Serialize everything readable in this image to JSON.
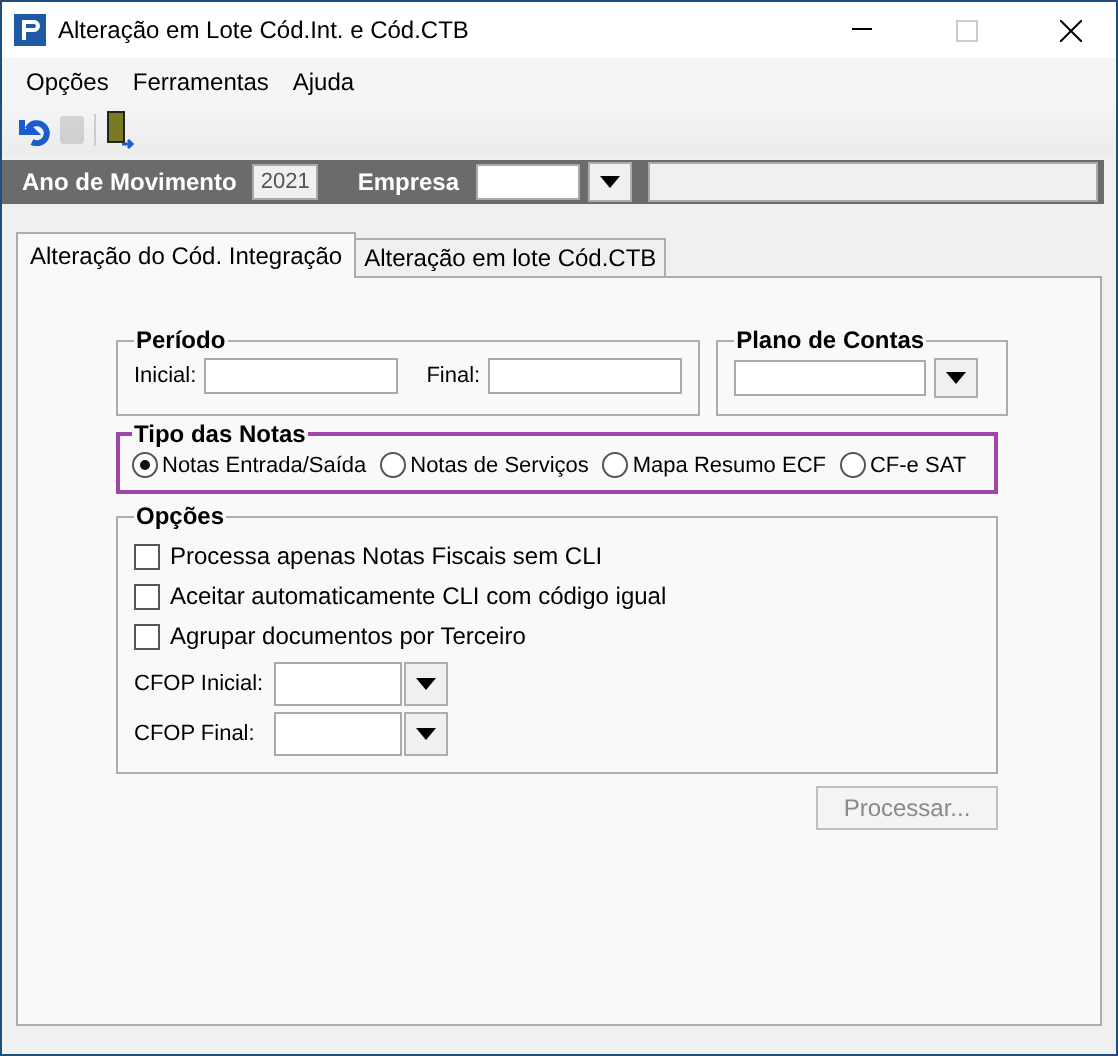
{
  "window": {
    "title": "Alteração em Lote Cód.Int. e Cód.CTB"
  },
  "menu": [
    "Opções",
    "Ferramentas",
    "Ajuda"
  ],
  "toolbar": [
    {
      "kind": "undo",
      "disabled": false
    },
    {
      "kind": "blank",
      "disabled": true
    },
    {
      "kind": "exit",
      "disabled": false
    }
  ],
  "header": {
    "year_label": "Ano de Movimento",
    "year": "2021",
    "company_label": "Empresa"
  },
  "tabs": [
    {
      "label": "Alteração do Cód. Integração",
      "selected": true
    },
    {
      "label": "Alteração em lote Cód.CTB",
      "selected": false
    }
  ],
  "periodo": {
    "title": "Período",
    "initial_label": "Inicial:",
    "final_label": "Final:"
  },
  "plano": {
    "title": "Plano de Contas"
  },
  "tipo": {
    "title": "Tipo das Notas",
    "options": [
      {
        "label": "Notas Entrada/Saída",
        "selected": true
      },
      {
        "label": "Notas de Serviços",
        "selected": false
      },
      {
        "label": "Mapa Resumo ECF",
        "selected": false
      },
      {
        "label": "CF-e SAT",
        "selected": false
      }
    ]
  },
  "opcoes": {
    "title": "Opções",
    "checks": [
      {
        "label": "Processa apenas Notas Fiscais sem CLI",
        "checked": false
      },
      {
        "label": "Aceitar automaticamente CLI com código igual",
        "checked": false
      },
      {
        "label": "Agrupar documentos por Terceiro",
        "checked": false
      }
    ],
    "combos": [
      {
        "label": "CFOP Inicial:"
      },
      {
        "label": "CFOP Final:"
      }
    ]
  },
  "process_button": {
    "label": "Processar...",
    "disabled": true
  }
}
